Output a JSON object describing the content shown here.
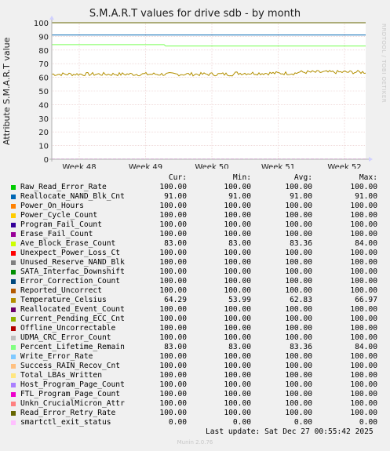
{
  "chart_data": {
    "type": "line",
    "title": "S.M.A.R.T values for drive sdb - by month",
    "ylabel": "Attribute S.M.A.R.T value",
    "ylim": [
      0,
      100
    ],
    "y_ticks": [
      0,
      10,
      20,
      30,
      40,
      50,
      60,
      70,
      80,
      90,
      100
    ],
    "x_ticks": [
      "Week 48",
      "Week 49",
      "Week 50",
      "Week 51",
      "Week 52"
    ],
    "grid": true,
    "columns": [
      "Cur:",
      "Min:",
      "Avg:",
      "Max:"
    ],
    "series": [
      {
        "name": "Raw_Read_Error_Rate",
        "color": "#00cc00",
        "cur": "100.00",
        "min": "100.00",
        "avg": "100.00",
        "max": "100.00"
      },
      {
        "name": "Reallocate_NAND_Blk_Cnt",
        "color": "#0066b3",
        "cur": "91.00",
        "min": "91.00",
        "avg": "91.00",
        "max": "91.00"
      },
      {
        "name": "Power_On_Hours",
        "color": "#ff8000",
        "cur": "100.00",
        "min": "100.00",
        "avg": "100.00",
        "max": "100.00"
      },
      {
        "name": "Power_Cycle_Count",
        "color": "#ffcc00",
        "cur": "100.00",
        "min": "100.00",
        "avg": "100.00",
        "max": "100.00"
      },
      {
        "name": "Program_Fail_Count",
        "color": "#330099",
        "cur": "100.00",
        "min": "100.00",
        "avg": "100.00",
        "max": "100.00"
      },
      {
        "name": "Erase_Fail_Count",
        "color": "#990099",
        "cur": "100.00",
        "min": "100.00",
        "avg": "100.00",
        "max": "100.00"
      },
      {
        "name": "Ave_Block_Erase_Count",
        "color": "#ccff00",
        "cur": "83.00",
        "min": "83.00",
        "avg": "83.36",
        "max": "84.00"
      },
      {
        "name": "Unexpect_Power_Loss_Ct",
        "color": "#ff0000",
        "cur": "100.00",
        "min": "100.00",
        "avg": "100.00",
        "max": "100.00"
      },
      {
        "name": "Unused_Reserve_NAND_Blk",
        "color": "#808080",
        "cur": "100.00",
        "min": "100.00",
        "avg": "100.00",
        "max": "100.00"
      },
      {
        "name": "SATA_Interfac_Downshift",
        "color": "#008f00",
        "cur": "100.00",
        "min": "100.00",
        "avg": "100.00",
        "max": "100.00"
      },
      {
        "name": "Error_Correction_Count",
        "color": "#00487d",
        "cur": "100.00",
        "min": "100.00",
        "avg": "100.00",
        "max": "100.00"
      },
      {
        "name": "Reported_Uncorrect",
        "color": "#b35a00",
        "cur": "100.00",
        "min": "100.00",
        "avg": "100.00",
        "max": "100.00"
      },
      {
        "name": "Temperature_Celsius",
        "color": "#b38f00",
        "cur": "64.29",
        "min": "53.99",
        "avg": "62.83",
        "max": "66.97"
      },
      {
        "name": "Reallocated_Event_Count",
        "color": "#6b006b",
        "cur": "100.00",
        "min": "100.00",
        "avg": "100.00",
        "max": "100.00"
      },
      {
        "name": "Current_Pending_ECC_Cnt",
        "color": "#8fb300",
        "cur": "100.00",
        "min": "100.00",
        "avg": "100.00",
        "max": "100.00"
      },
      {
        "name": "Offline_Uncorrectable",
        "color": "#b30000",
        "cur": "100.00",
        "min": "100.00",
        "avg": "100.00",
        "max": "100.00"
      },
      {
        "name": "UDMA_CRC_Error_Count",
        "color": "#bebebe",
        "cur": "100.00",
        "min": "100.00",
        "avg": "100.00",
        "max": "100.00"
      },
      {
        "name": "Percent_Lifetime_Remain",
        "color": "#80ff80",
        "cur": "83.00",
        "min": "83.00",
        "avg": "83.36",
        "max": "84.00"
      },
      {
        "name": "Write_Error_Rate",
        "color": "#80c9ff",
        "cur": "100.00",
        "min": "100.00",
        "avg": "100.00",
        "max": "100.00"
      },
      {
        "name": "Success_RAIN_Recov_Cnt",
        "color": "#ffc080",
        "cur": "100.00",
        "min": "100.00",
        "avg": "100.00",
        "max": "100.00"
      },
      {
        "name": "Total_LBAs_Written",
        "color": "#ffe680",
        "cur": "100.00",
        "min": "100.00",
        "avg": "100.00",
        "max": "100.00"
      },
      {
        "name": "Host_Program_Page_Count",
        "color": "#aa80ff",
        "cur": "100.00",
        "min": "100.00",
        "avg": "100.00",
        "max": "100.00"
      },
      {
        "name": "FTL_Program_Page_Count",
        "color": "#ee00cc",
        "cur": "100.00",
        "min": "100.00",
        "avg": "100.00",
        "max": "100.00"
      },
      {
        "name": "Unkn_CrucialMicron_Attr",
        "color": "#ff8080",
        "cur": "100.00",
        "min": "100.00",
        "avg": "100.00",
        "max": "100.00"
      },
      {
        "name": "Read_Error_Retry_Rate",
        "color": "#666600",
        "cur": "100.00",
        "min": "100.00",
        "avg": "100.00",
        "max": "100.00"
      },
      {
        "name": "smartctl_exit_status",
        "color": "#ffbfff",
        "cur": "0.00",
        "min": "0.00",
        "avg": "0.00",
        "max": "0.00"
      }
    ]
  },
  "watermark": "RRDTOOL / TOBI OETIKER",
  "last_update": "Last update: Sat Dec 27 00:55:42 2025",
  "version": "Munin 2.0.76"
}
